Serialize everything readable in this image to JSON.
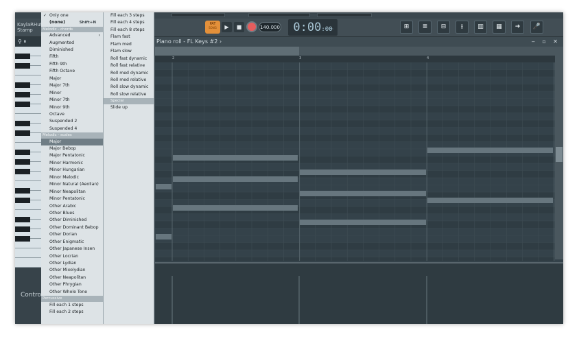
{
  "app": {
    "user_title_line1": "KaylaRHutt",
    "user_title_line2": "Stamp"
  },
  "transport": {
    "pat_label": "PAT",
    "song_label": "SONG",
    "play_glyph": "▶",
    "stop_glyph": "■",
    "tempo": "140.000",
    "time_main": "0:00",
    "time_sub": ":00",
    "time_unit": "M:S:CS"
  },
  "toolbar_icons": [
    "playlist-icon",
    "piano-roll-icon",
    "channel-rack-icon",
    "mixer-icon",
    "plugin-picker-icon",
    "piano-keyboard-icon",
    "arrow-right-icon",
    "microphone-icon"
  ],
  "toolbar_glyphs": [
    "⊞",
    "≣",
    "⊟",
    "⫲",
    "▥",
    "▦",
    "➜",
    "🎤"
  ],
  "left": {
    "header": "⚲ ⏸",
    "control_label": "Control"
  },
  "roll": {
    "title": "Piano roll - FL Keys #2 ›",
    "window_controls": "‒ ▫ ✕",
    "ruler": [
      "2",
      "3",
      "4"
    ]
  },
  "menu1": {
    "items": [
      {
        "label": "Only one",
        "type": "check"
      },
      {
        "label": "(none)",
        "shortcut": "Shift+N",
        "type": "bold"
      },
      {
        "label": "Melodic - chords",
        "type": "section"
      },
      {
        "label": "Advanced",
        "type": "submenu"
      },
      {
        "label": "Augmented"
      },
      {
        "label": "Diminished"
      },
      {
        "label": "Fifth"
      },
      {
        "label": "Fifth 9th"
      },
      {
        "label": "Fifth Octave"
      },
      {
        "label": "Major"
      },
      {
        "label": "Major 7th"
      },
      {
        "label": "Minor"
      },
      {
        "label": "Minor 7th"
      },
      {
        "label": "Minor 9th"
      },
      {
        "label": "Octave"
      },
      {
        "label": "Suspended 2"
      },
      {
        "label": "Suspended 4"
      },
      {
        "label": "Melodic - scales",
        "type": "section"
      },
      {
        "label": "Major",
        "type": "selected"
      },
      {
        "label": "Major Bebop"
      },
      {
        "label": "Major Pentatonic"
      },
      {
        "label": "Minor Harmonic"
      },
      {
        "label": "Minor Hungarian"
      },
      {
        "label": "Minor Melodic"
      },
      {
        "label": "Minor Natural (Aeolian)"
      },
      {
        "label": "Minor Neapolitan"
      },
      {
        "label": "Minor Pentatonic"
      },
      {
        "label": "Other Arabic"
      },
      {
        "label": "Other Blues"
      },
      {
        "label": "Other Diminished"
      },
      {
        "label": "Other Dominant Bebop"
      },
      {
        "label": "Other Dorian"
      },
      {
        "label": "Other Enigmatic"
      },
      {
        "label": "Other Japanese Insen"
      },
      {
        "label": "Other Locrian"
      },
      {
        "label": "Other Lydian"
      },
      {
        "label": "Other Mixolydian"
      },
      {
        "label": "Other Neapolitan"
      },
      {
        "label": "Other Phrygian"
      },
      {
        "label": "Other Whole Tone"
      },
      {
        "label": "Percussive",
        "type": "section"
      },
      {
        "label": "Fill each 1 steps"
      },
      {
        "label": "Fill each 2 steps"
      }
    ]
  },
  "menu2": {
    "items": [
      {
        "label": "Fill each 3 steps"
      },
      {
        "label": "Fill each 4 steps"
      },
      {
        "label": "Fill each 8 steps"
      },
      {
        "label": "Flam fast"
      },
      {
        "label": "Flam med"
      },
      {
        "label": "Flam slow"
      },
      {
        "label": "Roll fast dynamic"
      },
      {
        "label": "Roll fast relative"
      },
      {
        "label": "Roll med dynamic"
      },
      {
        "label": "Roll med relative"
      },
      {
        "label": "Roll slow dynamic"
      },
      {
        "label": "Roll slow relative"
      },
      {
        "label": "Special",
        "type": "section"
      },
      {
        "label": "Slide up"
      }
    ]
  },
  "colors": {
    "note": "#67767e",
    "pat": "#e3903a",
    "record": "#e55d5d",
    "menu_bg": "#dde3e6",
    "menu_selected": "#6f7d85"
  }
}
